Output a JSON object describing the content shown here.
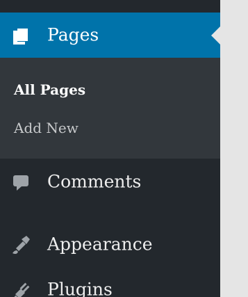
{
  "sidebar": {
    "items": [
      {
        "label": "Pages",
        "icon": "pages-icon",
        "current": true
      },
      {
        "label": "Comments",
        "icon": "comment-icon"
      },
      {
        "label": "Appearance",
        "icon": "paintbrush-icon"
      },
      {
        "label": "Plugins",
        "icon": "plugin-icon"
      }
    ],
    "submenu": [
      {
        "label": "All Pages",
        "current": true
      },
      {
        "label": "Add New"
      }
    ]
  },
  "colors": {
    "sidebar_bg": "#23282d",
    "submenu_bg": "#32373c",
    "accent": "#0073aa",
    "content_bg": "#e5e5e5",
    "text": "#eeeeee",
    "submenu_text": "#c7c9cb"
  }
}
